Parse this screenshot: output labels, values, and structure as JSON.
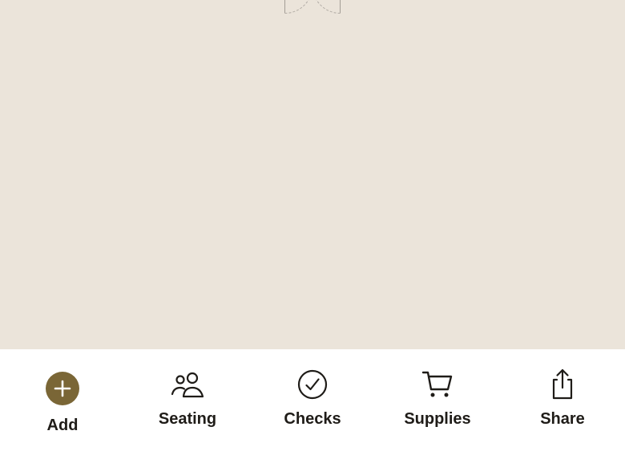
{
  "colors": {
    "canvas_background": "#ebe4da",
    "toolbar_background": "#ffffff",
    "accent": "#7a6636",
    "icon_color": "#1f1c18"
  },
  "canvas": {
    "icon": "door-swing-icon"
  },
  "toolbar": {
    "add": {
      "label": "Add",
      "icon": "plus-circle-icon"
    },
    "seating": {
      "label": "Seating",
      "icon": "people-icon"
    },
    "checks": {
      "label": "Checks",
      "icon": "check-circle-icon"
    },
    "supplies": {
      "label": "Supplies",
      "icon": "cart-icon"
    },
    "share": {
      "label": "Share",
      "icon": "share-icon"
    }
  }
}
